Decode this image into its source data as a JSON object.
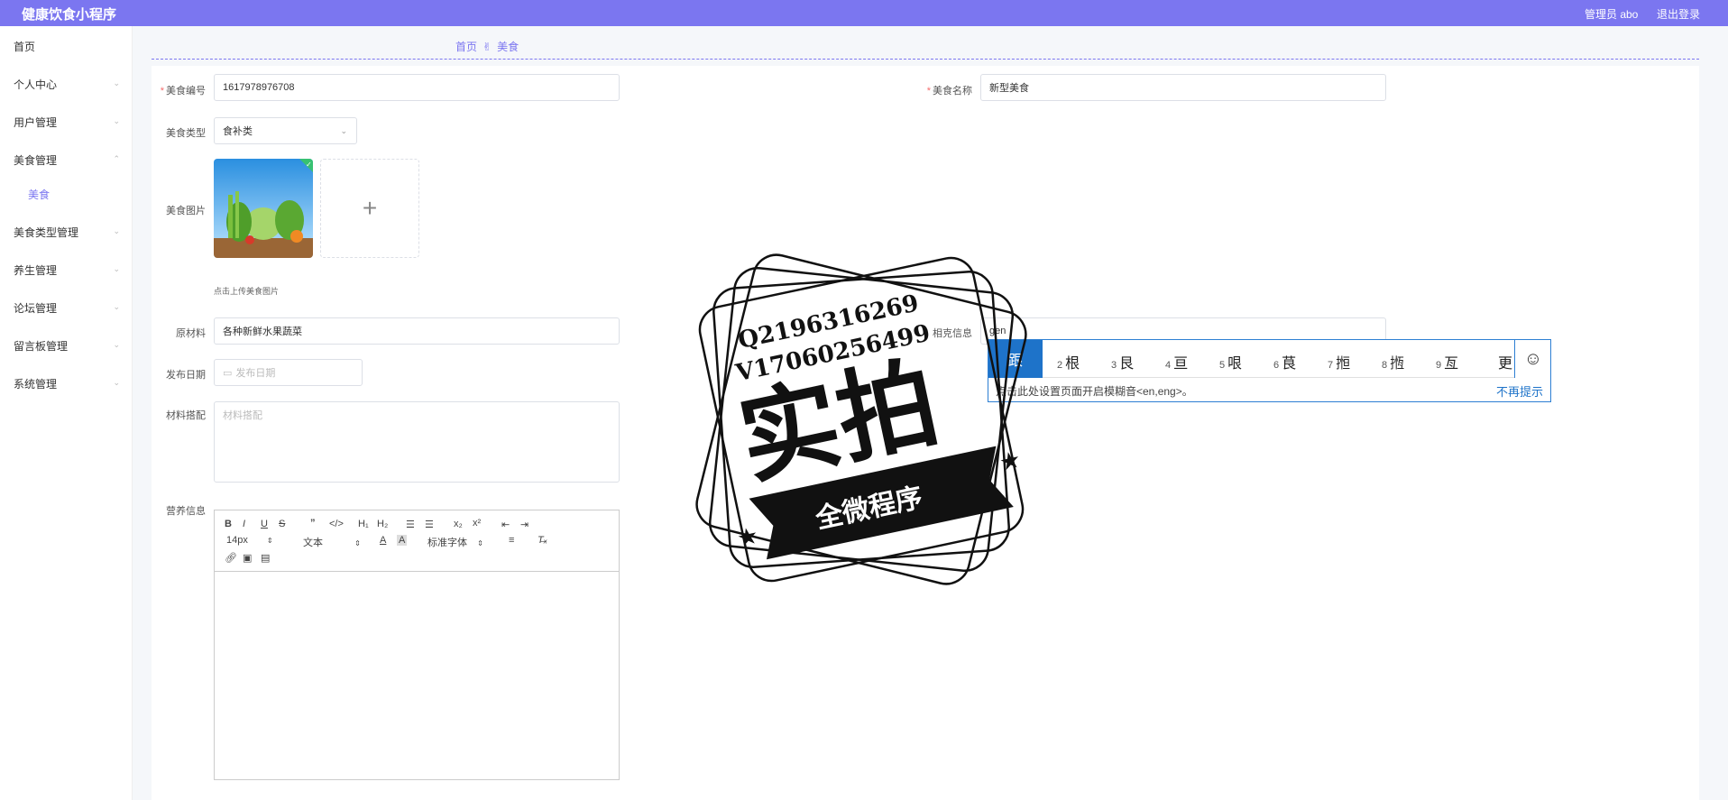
{
  "header": {
    "title": "健康饮食小程序",
    "admin": "管理员 abo",
    "logout": "退出登录"
  },
  "sidebar": {
    "items": [
      {
        "label": "首页",
        "chevron": ""
      },
      {
        "label": "个人中心",
        "chevron": "⌄"
      },
      {
        "label": "用户管理",
        "chevron": "⌄"
      },
      {
        "label": "美食管理",
        "chevron": "⌃"
      },
      {
        "label": "美食类型管理",
        "chevron": "⌄"
      },
      {
        "label": "养生管理",
        "chevron": "⌄"
      },
      {
        "label": "论坛管理",
        "chevron": "⌄"
      },
      {
        "label": "留言板管理",
        "chevron": "⌄"
      },
      {
        "label": "系统管理",
        "chevron": "⌄"
      }
    ],
    "sub_item": "美食"
  },
  "breadcrumb": {
    "home": "首页",
    "current": "美食",
    "icon": "hand-icon"
  },
  "form": {
    "food_no": {
      "label": "美食编号",
      "value": "1617978976708"
    },
    "food_name": {
      "label": "美食名称",
      "value": "新型美食"
    },
    "food_type": {
      "label": "美食类型",
      "value": "食补类"
    },
    "food_image": {
      "label": "美食图片",
      "tip": "点击上传美食图片"
    },
    "ingredients": {
      "label": "原材料",
      "value": "各种新鲜水果蔬菜"
    },
    "related": {
      "label": "相克信息",
      "value": "gen"
    },
    "publish_date": {
      "label": "发布日期",
      "placeholder": "发布日期"
    },
    "pairing": {
      "label": "材料搭配",
      "placeholder": "材料搭配"
    },
    "nutrition": {
      "label": "营养信息"
    }
  },
  "editor": {
    "font_size": "14px",
    "text_style": "文本",
    "font_family": "标准字体"
  },
  "ime": {
    "first": "跟",
    "candidates": [
      {
        "num": "2",
        "text": "根"
      },
      {
        "num": "3",
        "text": "艮"
      },
      {
        "num": "4",
        "text": "亘"
      },
      {
        "num": "5",
        "text": "哏"
      },
      {
        "num": "6",
        "text": "茛"
      },
      {
        "num": "7",
        "text": "搄"
      },
      {
        "num": "8",
        "text": "揯"
      },
      {
        "num": "9",
        "text": "亙"
      }
    ],
    "more": "更",
    "hint": "点击此处设置页面开启模糊音<en,eng>。",
    "no_remind": "不再提示"
  },
  "watermark": {
    "qq": "Q2196316269",
    "vx": "V17060256499",
    "big": "实拍",
    "ribbon": "全微程序"
  },
  "colors": {
    "accent": "#7b76f0",
    "ime_blue": "#1e73c9",
    "required": "#f56c6c"
  }
}
